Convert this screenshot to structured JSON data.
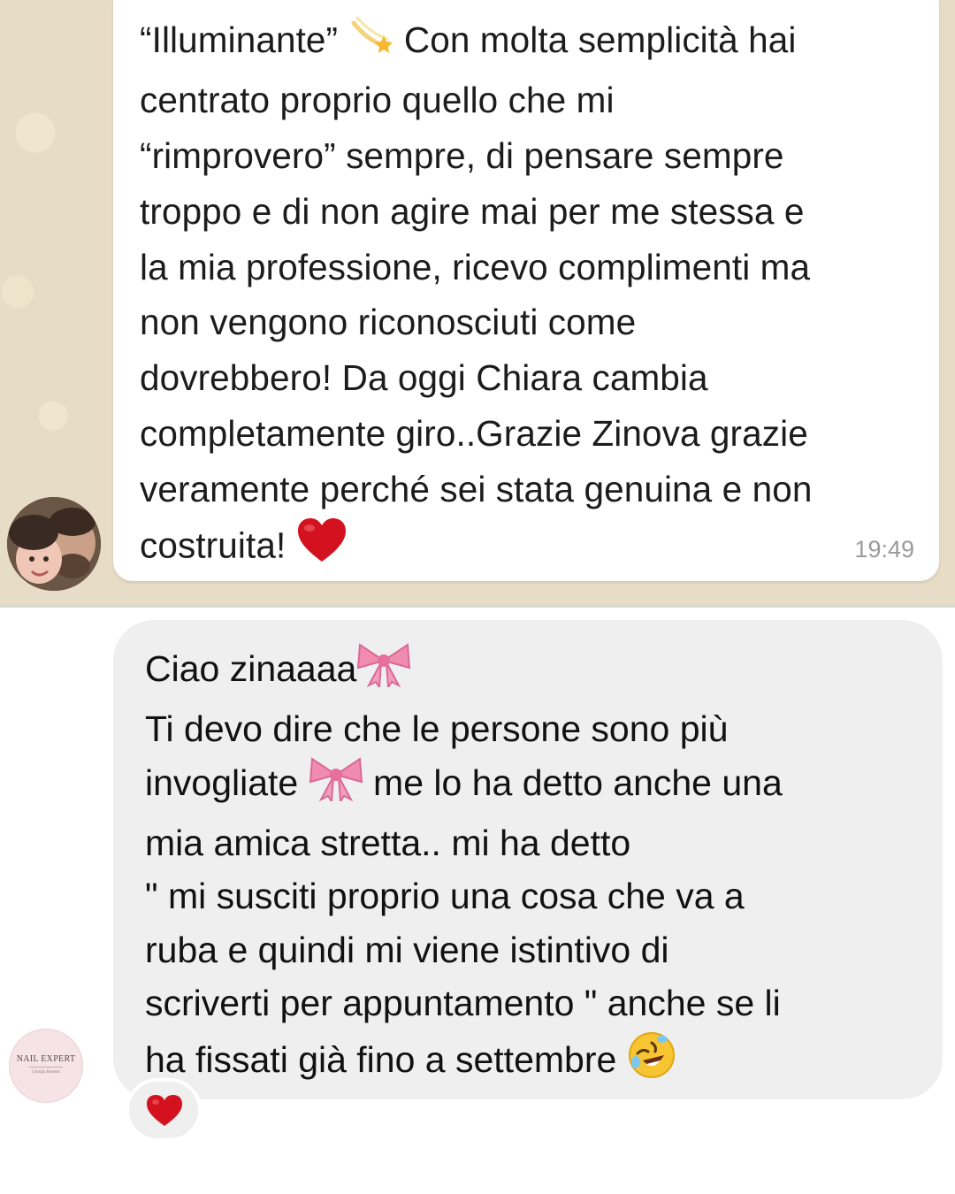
{
  "whatsapp_message": {
    "lines": [
      "“Illuminante”",
      "Con molta semplicità hai",
      "centrato proprio quello che mi",
      "“rimprovero” sempre, di pensare sempre",
      "troppo e di non agire mai per me stessa e",
      "la mia professione, ricevo complimenti ma",
      "non vengono riconosciuti come",
      "dovrebbero! Da oggi Chiara cambia",
      "completamente giro..Grazie Zinova grazie",
      "veramente perché sei stata genuina e non",
      "costruita!"
    ],
    "time": "19:49",
    "emojis": [
      "shooting-star-icon",
      "red-heart-icon"
    ]
  },
  "instagram_message": {
    "lines": [
      "Ciao zinaaaa",
      "Ti devo dire che le persone sono più",
      "invogliate",
      "me lo ha detto anche una",
      "mia amica stretta.. mi ha detto",
      "\" mi susciti proprio una cosa che va a",
      "ruba e quindi mi viene istintivo di",
      "scriverti per appuntamento \" anche se li",
      "ha fissati già fino a settembre"
    ],
    "emojis": [
      "pink-ribbon-icon",
      "rolling-laughing-face-icon"
    ],
    "reaction": "red-heart-icon"
  },
  "sender_avatar_logo": {
    "title": "NAIL EXPERT",
    "subtitle": "Giorgia Boretto"
  },
  "colors": {
    "whatsapp_background": "#e7dcc6",
    "whatsapp_bubble": "#ffffff",
    "instagram_bubble": "#efefef",
    "heart": "#d4121f",
    "ribbon": "#f28bb0"
  }
}
